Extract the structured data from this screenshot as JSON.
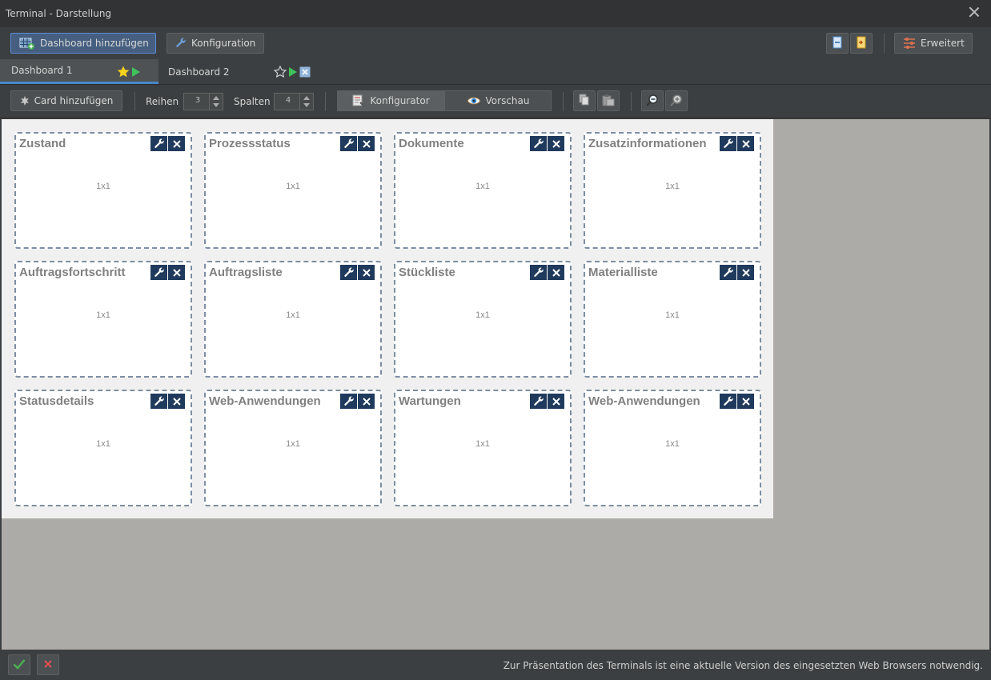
{
  "window": {
    "title": "Terminal - Darstellung"
  },
  "top_toolbar": {
    "add_dashboard_label": "Dashboard hinzufügen",
    "configuration_label": "Konfiguration",
    "advanced_label": "Erweitert"
  },
  "tabs": [
    {
      "label": "Dashboard 1",
      "favorite": true
    },
    {
      "label": "Dashboard 2",
      "favorite": false
    }
  ],
  "config_toolbar": {
    "add_card_label": "Card hinzufügen",
    "rows_label": "Reihen",
    "rows_value": "3",
    "columns_label": "Spalten",
    "columns_value": "4",
    "configurator_label": "Konfigurator",
    "preview_label": "Vorschau"
  },
  "cards": [
    {
      "title": "Zustand",
      "size": "1x1"
    },
    {
      "title": "Prozessstatus",
      "size": "1x1"
    },
    {
      "title": "Dokumente",
      "size": "1x1"
    },
    {
      "title": "Zusatzinformationen",
      "size": "1x1"
    },
    {
      "title": "Auftragsfortschritt",
      "size": "1x1"
    },
    {
      "title": "Auftragsliste",
      "size": "1x1"
    },
    {
      "title": "Stückliste",
      "size": "1x1"
    },
    {
      "title": "Materialliste",
      "size": "1x1"
    },
    {
      "title": "Statusdetails",
      "size": "1x1"
    },
    {
      "title": "Web-Anwendungen",
      "size": "1x1"
    },
    {
      "title": "Wartungen",
      "size": "1x1"
    },
    {
      "title": "Web-Anwendungen",
      "size": "1x1"
    }
  ],
  "status": {
    "message": "Zur Präsentation des Terminals ist eine aktuelle Version des eingesetzten Web Browsers notwendig."
  },
  "colors": {
    "accent": "#4a88c7",
    "card_button": "#1f3a5c",
    "ok_green": "#4caf50",
    "cancel_red": "#e05050"
  }
}
